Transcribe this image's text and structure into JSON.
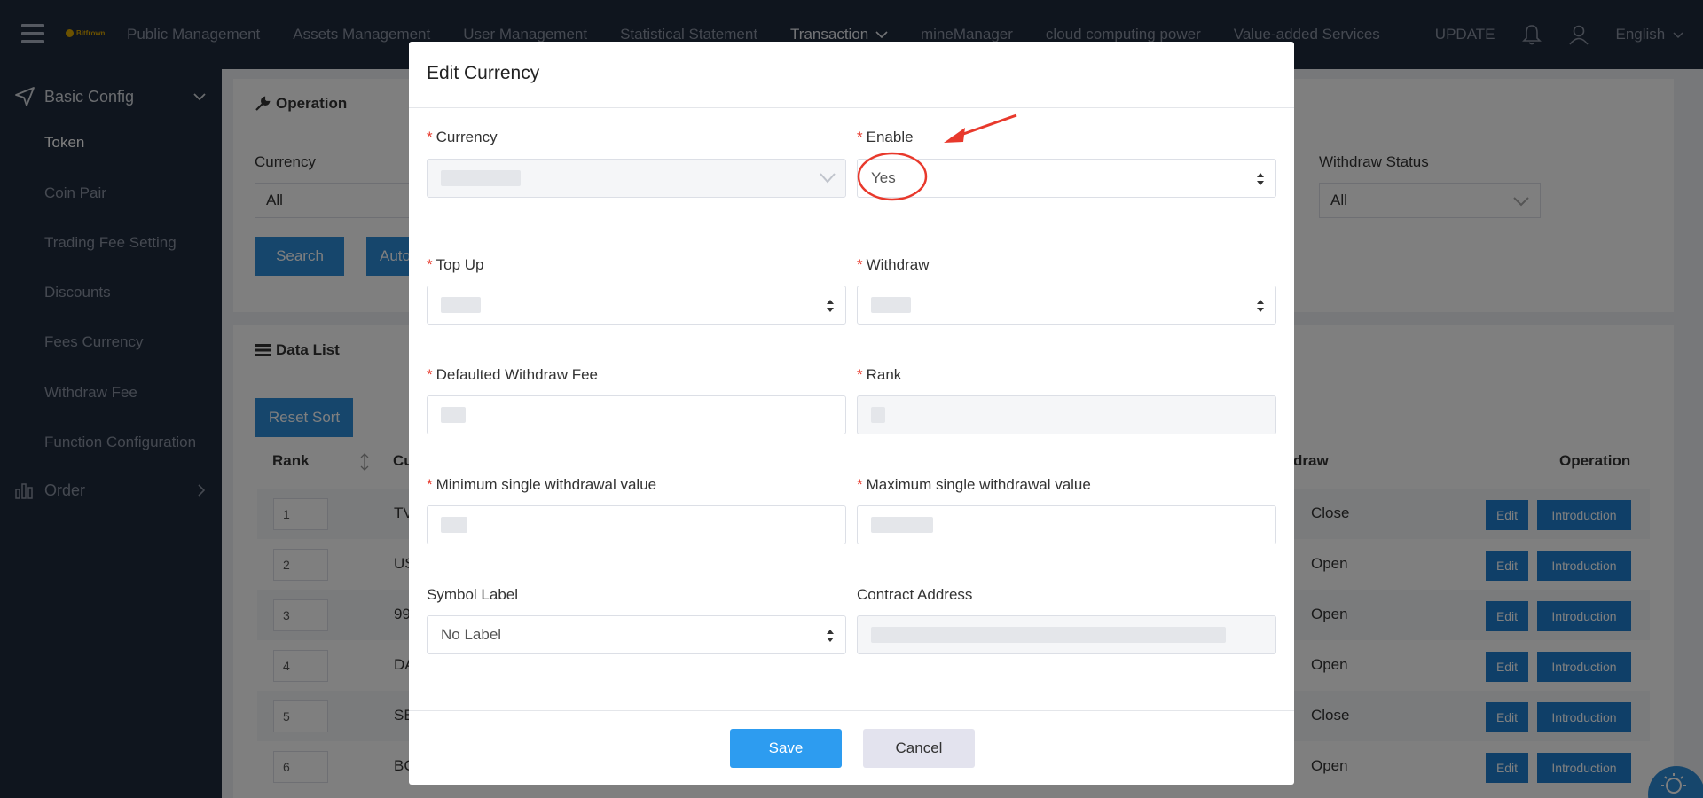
{
  "topnav": {
    "logo_text": "Bitfrown",
    "items": [
      {
        "label": "Public Management"
      },
      {
        "label": "Assets Management"
      },
      {
        "label": "User Management"
      },
      {
        "label": "Statistical Statement"
      },
      {
        "label": "Transaction",
        "active": true
      },
      {
        "label": "mineManager"
      },
      {
        "label": "cloud computing power"
      },
      {
        "label": "Value-added Services"
      }
    ],
    "update_label": "UPDATE",
    "language": "English"
  },
  "sidebar": {
    "group_basic": "Basic Config",
    "items": [
      "Token",
      "Coin Pair",
      "Trading Fee Setting",
      "Discounts",
      "Fees Currency",
      "Withdraw Fee",
      "Function Configuration"
    ],
    "group_order": "Order"
  },
  "operation": {
    "title": "Operation",
    "currency_label": "Currency",
    "currency_value": "All",
    "withdraw_status_label": "Withdraw Status",
    "withdraw_status_value": "All",
    "search_label": "Search",
    "auto_label": "Auto"
  },
  "data_list": {
    "title": "Data List",
    "reset_sort_label": "Reset Sort",
    "headers": {
      "rank": "Rank",
      "currency": "Cu",
      "withdraw": "draw",
      "operation": "Operation"
    },
    "edit_label": "Edit",
    "intro_label": "Introduction",
    "rows": [
      {
        "rank": "1",
        "currency": "TV",
        "withdraw": "Close"
      },
      {
        "rank": "2",
        "currency": "US",
        "withdraw": "Open"
      },
      {
        "rank": "3",
        "currency": "99",
        "withdraw": "Open"
      },
      {
        "rank": "4",
        "currency": "DA",
        "withdraw": "Open"
      },
      {
        "rank": "5",
        "currency": "SB",
        "withdraw": "Close"
      },
      {
        "rank": "6",
        "currency": "BC",
        "withdraw": "Open"
      }
    ]
  },
  "modal": {
    "title": "Edit Currency",
    "currency_label": "Currency",
    "enable_label": "Enable",
    "enable_value": "Yes",
    "topup_label": "Top Up",
    "withdraw_label": "Withdraw",
    "default_fee_label": "Defaulted Withdraw Fee",
    "rank_label": "Rank",
    "min_label": "Minimum single withdrawal value",
    "max_label": "Maximum single withdrawal value",
    "symbol_label": "Symbol Label",
    "symbol_value": "No Label",
    "contract_label": "Contract Address",
    "save_label": "Save",
    "cancel_label": "Cancel"
  },
  "colors": {
    "nav_bg": "#1f2a3c",
    "primary": "#2d9cf0",
    "required": "#e8392c",
    "annotation": "#e8392c"
  }
}
